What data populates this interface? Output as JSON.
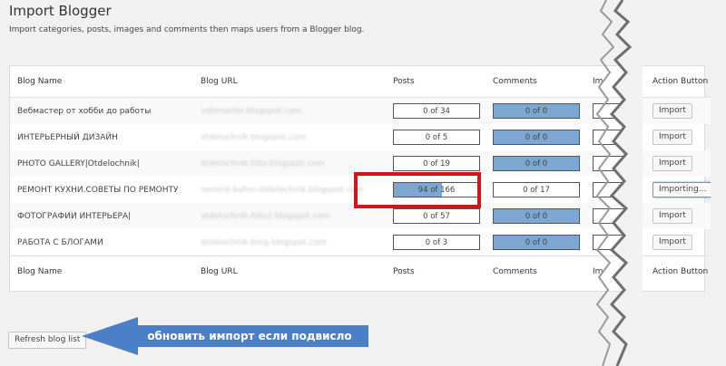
{
  "page": {
    "title": "Import Blogger",
    "subtitle": "Import categories, posts, images and comments then maps users from a Blogger blog."
  },
  "table": {
    "headers": {
      "blog_name": "Blog Name",
      "blog_url": "Blog URL",
      "posts": "Posts",
      "comments": "Comments",
      "images": "Im",
      "action": "Action Button"
    },
    "rows": [
      {
        "name": "Вебмастер от хобби до работы",
        "url": "vebmaster.blogspot.com",
        "posts": "0 of 34",
        "posts_fill": 0,
        "comments": "0 of 0",
        "comments_fill": 1,
        "action": "Import"
      },
      {
        "name": "ИНТЕРЬЕРНЫЙ ДИЗАЙН",
        "url": "otdelochnik.blogspot.com",
        "posts": "0 of 5",
        "posts_fill": 0,
        "comments": "0 of 0",
        "comments_fill": 1,
        "action": "Import"
      },
      {
        "name": "PHOTO GALLERY|Otdelochnik|",
        "url": "otdelochnik-foto.blogspot.com",
        "posts": "0 of 19",
        "posts_fill": 0,
        "comments": "0 of 0",
        "comments_fill": 1,
        "action": "Import"
      },
      {
        "name": "РЕМОНТ КУХНИ.СОВЕТЫ ПО РЕМОНТУ",
        "url": "remont-kuhni-otdelochnik.blogspot.com",
        "posts": "94 of 166",
        "posts_fill": 0.566,
        "comments": "0 of 17",
        "comments_fill": 0,
        "action": "Importing..."
      },
      {
        "name": "ФОТОГРАФИИ ИНТЕРЬЕРА|",
        "url": "otdelochnik-foto2.blogspot.com",
        "posts": "0 of 57",
        "posts_fill": 0,
        "comments": "0 of 0",
        "comments_fill": 1,
        "action": "Import"
      },
      {
        "name": "РАБОТА С БЛОГАМИ",
        "url": "otdelochnik-blog.blogspot.com",
        "posts": "0 of 3",
        "posts_fill": 0,
        "comments": "0 of 0",
        "comments_fill": 1,
        "action": "Import"
      }
    ]
  },
  "refresh_button": "Refresh blog list",
  "annotation": "обновить импорт если подвисло",
  "colors": {
    "progress_fill": "#7ba7d2",
    "highlight": "#d4141c",
    "arrow": "#4b7fc7"
  }
}
